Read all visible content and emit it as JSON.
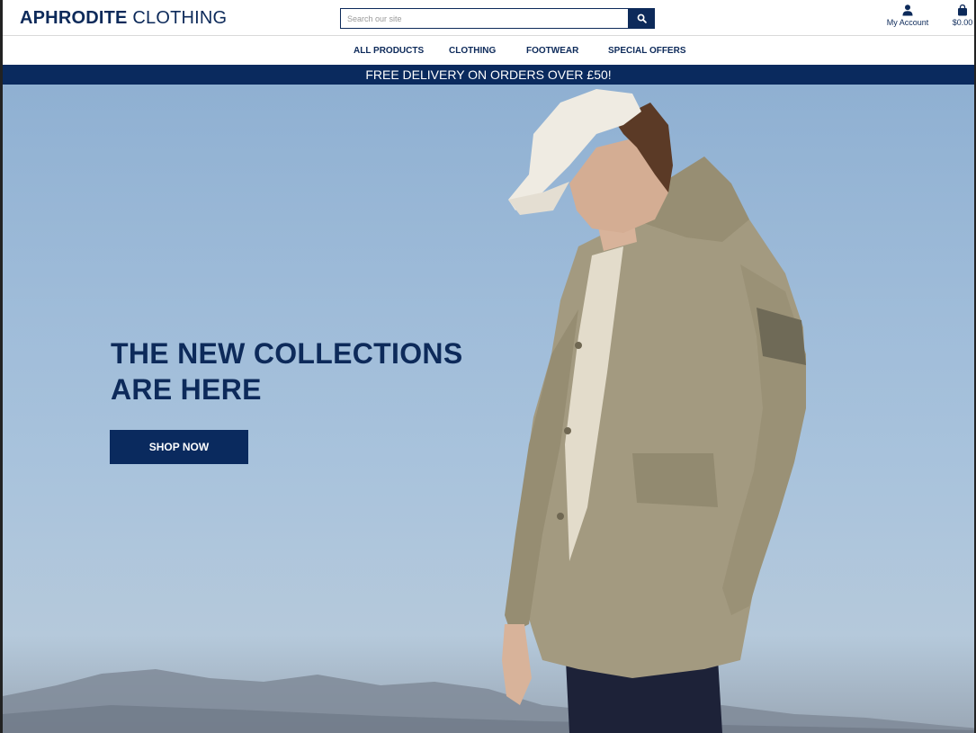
{
  "header": {
    "logo_bold": "APHRODITE",
    "logo_regular": " CLOTHING",
    "search_placeholder": "Search our site",
    "account_label": "My Account",
    "bag_total": "$0.00"
  },
  "nav": {
    "items": [
      {
        "label": "ALL PRODUCTS"
      },
      {
        "label": "CLOTHING"
      },
      {
        "label": "FOOTWEAR"
      },
      {
        "label": "SPECIAL OFFERS"
      }
    ]
  },
  "promo": {
    "text": "FREE DELIVERY ON ORDERS OVER £50!"
  },
  "hero": {
    "title_line1": "THE NEW COLLECTIONS",
    "title_line2": "ARE HERE",
    "cta_label": "SHOP NOW"
  },
  "colors": {
    "brand_navy": "#0a2a5e",
    "text_navy": "#0d2a5a",
    "sky": "#9fbcd9",
    "jacket": "#a39a80"
  },
  "icons": {
    "search": "search-icon",
    "account": "user-icon",
    "bag": "shopping-bag-icon"
  }
}
